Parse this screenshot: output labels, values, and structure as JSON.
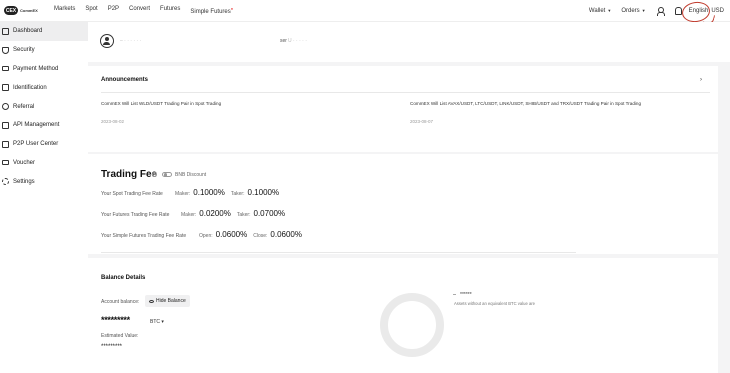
{
  "header": {
    "logo_mark": "CEX",
    "logo_text": "CommEX",
    "nav": [
      "Markets",
      "Spot",
      "P2P",
      "Convert",
      "Futures",
      "Simple Futures"
    ],
    "nav_badge": "●",
    "wallet": "Wallet",
    "orders": "Orders",
    "language": "English",
    "currency": "USD"
  },
  "sidebar": {
    "items": [
      {
        "label": "Dashboard",
        "icon": "dashboard-icon",
        "active": true
      },
      {
        "label": "Security",
        "icon": "shield-icon"
      },
      {
        "label": "Payment Method",
        "icon": "card-icon"
      },
      {
        "label": "Identification",
        "icon": "id-icon"
      },
      {
        "label": "Referral",
        "icon": "referral-icon"
      },
      {
        "label": "API Management",
        "icon": "api-icon"
      },
      {
        "label": "P2P User Center",
        "icon": "p2p-icon"
      },
      {
        "label": "Voucher",
        "icon": "voucher-icon"
      },
      {
        "label": "Settings",
        "icon": "settings-icon"
      }
    ]
  },
  "profile": {
    "name_masked": "– · · · · · ·",
    "user_suffix": "ser",
    "uid_masked": "U · · · · ·"
  },
  "announcements": {
    "title": "Announcements",
    "items": [
      {
        "text": "CommEX Will List WLD/USDT Trading Pair in Spot Trading",
        "date": "2023-08-02"
      },
      {
        "text": "CommEX Will List AVAX/USDT, LTC/USDT, LINK/USDT, SHIB/USDT and TRX/USDT Trading Pair in Spot Trading",
        "date": "2023-08-07"
      }
    ]
  },
  "trading_fee": {
    "title": "Trading Fee",
    "bnb_discount": "BNB Discount",
    "rows": [
      {
        "label": "Your Spot Trading Fee Rate",
        "k1": "Maker:",
        "v1": "0.1000%",
        "k2": "Taker:",
        "v2": "0.1000%"
      },
      {
        "label": "Your Futures Trading Fee Rate",
        "k1": "Maker:",
        "v1": "0.0200%",
        "k2": "Taker:",
        "v2": "0.0700%"
      },
      {
        "label": "Your Simple Futures Trading Fee Rate",
        "k1": "Open:",
        "v1": "0.0600%",
        "k2": "Close:",
        "v2": "0.0600%"
      }
    ]
  },
  "balance": {
    "title": "Balance Details",
    "account_label": "Account balance:",
    "hide_button": "Hide Balance",
    "balance_masked": "*********",
    "currency": "BTC",
    "estimated_label": "Estimated Value:",
    "estimated_masked": "*********",
    "legend_masked": "******",
    "legend_note": "Assets without an equivalent BTC value are"
  }
}
